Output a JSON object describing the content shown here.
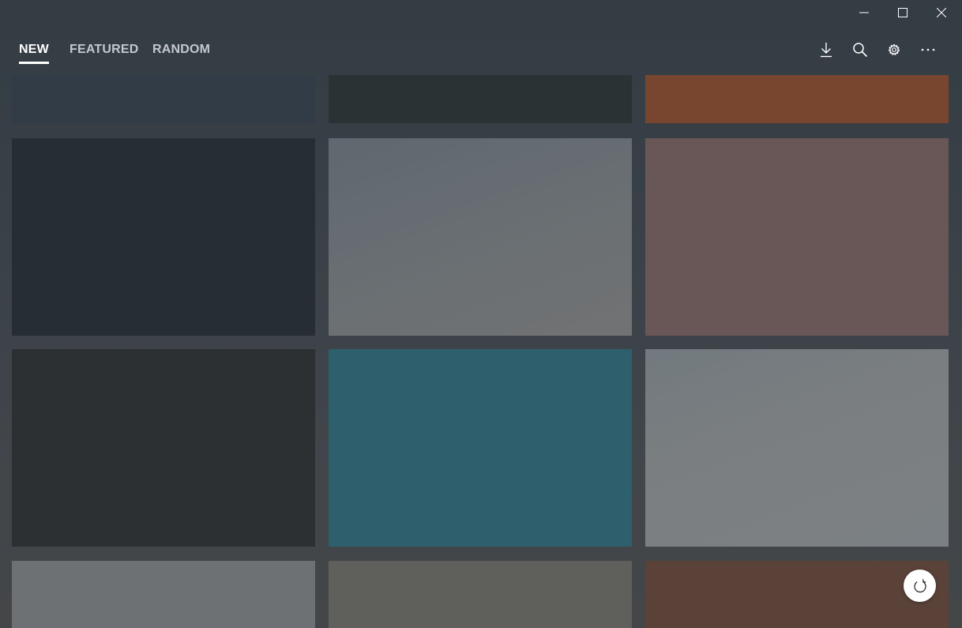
{
  "tabs": [
    {
      "label": "NEW",
      "active": true
    },
    {
      "label": "FEATURED",
      "active": false
    },
    {
      "label": "RANDOM",
      "active": false
    }
  ],
  "toolbar": {
    "icons": [
      "download-icon",
      "search-icon",
      "settings-icon",
      "more-icon"
    ]
  },
  "window_controls": [
    "minimize-icon",
    "maximize-icon",
    "close-icon"
  ],
  "tiles": [
    {
      "color": "#323c47"
    },
    {
      "color": "#2b3234"
    },
    {
      "color": "#78462f"
    },
    {
      "color": "#262d33"
    },
    {
      "color": "#676f73"
    },
    {
      "color": "#695657"
    },
    {
      "color": "#2d3033"
    },
    {
      "color": "#2d5f6d"
    },
    {
      "color": "#7b7f81"
    },
    {
      "color": "#6d7174"
    },
    {
      "color": "#5f605b"
    },
    {
      "color": "#5a4239"
    }
  ],
  "refresh_icon": "refresh-icon"
}
